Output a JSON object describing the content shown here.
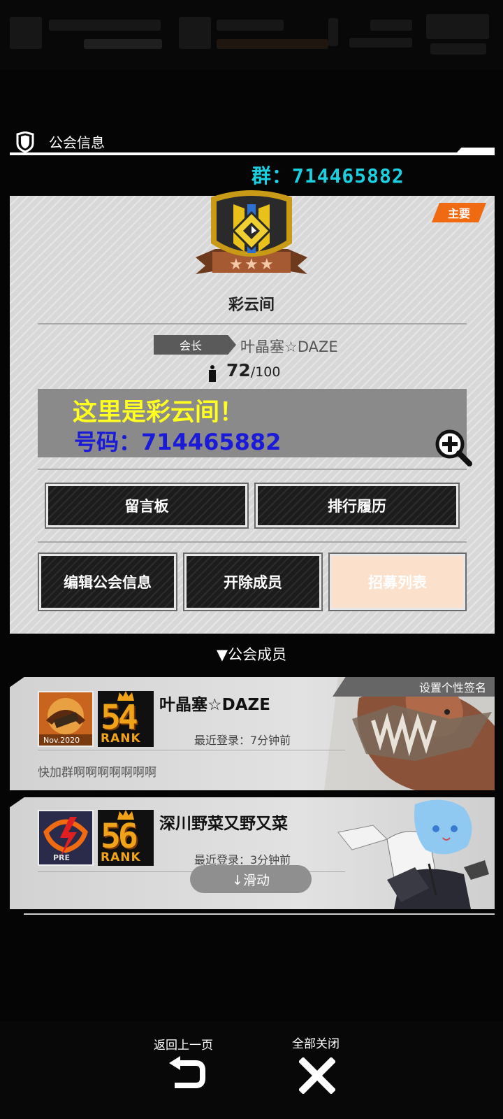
{
  "header": {
    "title": "公会信息",
    "group_number": "群：714465882"
  },
  "guild": {
    "tag_main": "主要",
    "name": "彩云间",
    "leader_label": "会长",
    "leader_name": "叶晶塞☆DAZE",
    "member_count": "72",
    "member_max": "/100",
    "description_line1": "这里是彩云间！",
    "description_line2": "号码：714465882",
    "buttons": {
      "message_board": "留言板",
      "ranking_history": "排行履历",
      "edit_info": "编辑公会信息",
      "remove_member": "开除成员",
      "recruit_list": "招募列表"
    }
  },
  "members_section": {
    "label": "▼公会成员",
    "set_signature": "设置个性签名",
    "members": [
      {
        "name": "叶晶塞☆DAZE",
        "rank_number": "54",
        "rank_label": "RANK",
        "last_login": "最近登录：7分钟前",
        "message": "快加群啊啊啊啊啊啊啊",
        "avatar_caption": "Nov.2020"
      },
      {
        "name": "深川野菜又野又菜",
        "rank_number": "56",
        "rank_label": "RANK",
        "last_login": "最近登录：3分钟前",
        "avatar_caption": "PRE"
      }
    ],
    "scroll_hint": "↓滑动"
  },
  "footer": {
    "back_label": "返回上一页",
    "close_all_label": "全部关闭"
  },
  "colors": {
    "accent_orange": "#f06a12",
    "group_number_cyan": "#1ad0e0",
    "desc_yellow": "#ffff20",
    "desc_blue": "#1a1ad8",
    "rank_gold": "#f0a218"
  }
}
